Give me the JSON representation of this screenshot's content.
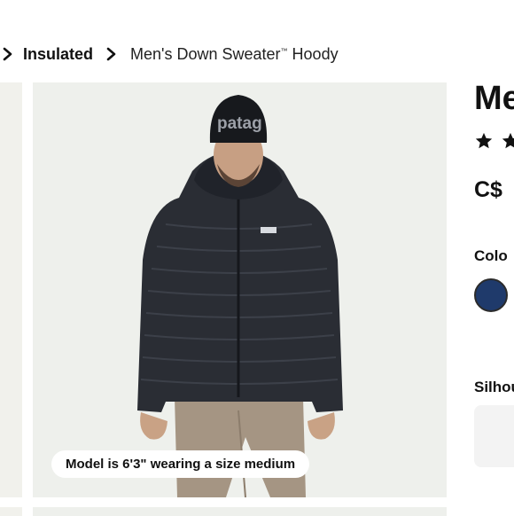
{
  "breadcrumb": {
    "items": [
      "Insulated",
      "Men's Down Sweater"
    ],
    "trademark": "™",
    "current_suffix": "Hoody"
  },
  "gallery": {
    "caption": "Model is 6'3\" wearing a size medium",
    "beanie_text": "patag"
  },
  "product": {
    "title": "Me",
    "rating_stars": 2,
    "price": "C$",
    "color_label": "Colo",
    "selected_color": "#1f3a6b",
    "silhouette_label": "Silhou"
  },
  "colors": {
    "jacket": "#2a2d34",
    "pants": "#a59583",
    "background": "#eef0ec"
  }
}
